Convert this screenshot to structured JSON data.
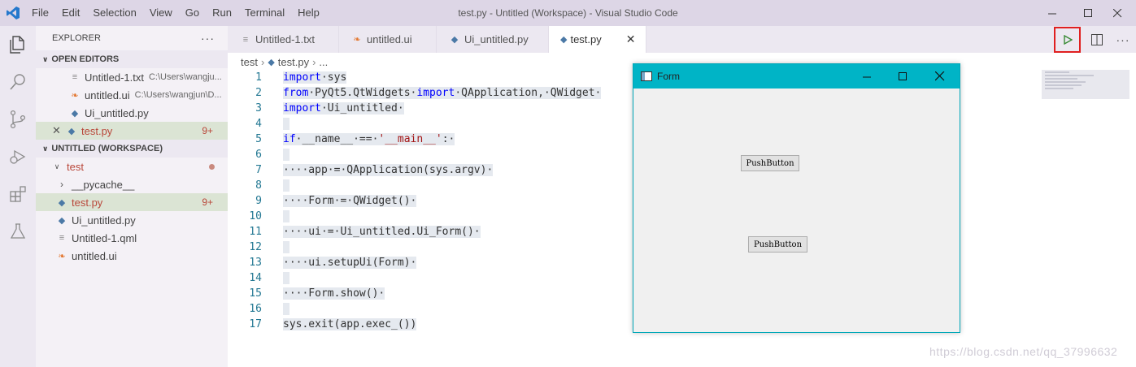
{
  "titlebar": {
    "menu": [
      "File",
      "Edit",
      "Selection",
      "View",
      "Go",
      "Run",
      "Terminal",
      "Help"
    ],
    "title": "test.py - Untitled (Workspace) - Visual Studio Code"
  },
  "sidebar": {
    "header": "EXPLORER",
    "more": "···",
    "open_editors": {
      "title": "OPEN EDITORS",
      "items": [
        {
          "name": "Untitled-1.txt",
          "path": "C:\\Users\\wangju..."
        },
        {
          "name": "untitled.ui",
          "path": "C:\\Users\\wangjun\\D..."
        },
        {
          "name": "Ui_untitled.py",
          "path": ""
        },
        {
          "name": "test.py",
          "path": "",
          "badge": "9+"
        }
      ]
    },
    "workspace": {
      "title": "UNTITLED (WORKSPACE)",
      "folder": "test",
      "items": [
        {
          "name": "__pycache__"
        },
        {
          "name": "test.py",
          "badge": "9+"
        },
        {
          "name": "Ui_untitled.py"
        },
        {
          "name": "Untitled-1.qml"
        },
        {
          "name": "untitled.ui"
        }
      ]
    }
  },
  "tabs": [
    {
      "label": "Untitled-1.txt"
    },
    {
      "label": "untitled.ui"
    },
    {
      "label": "Ui_untitled.py"
    },
    {
      "label": "test.py"
    }
  ],
  "breadcrumb": {
    "folder": "test",
    "file": "test.py",
    "rest": "..."
  },
  "editor": {
    "line_numbers": [
      "1",
      "2",
      "3",
      "4",
      "5",
      "6",
      "7",
      "8",
      "9",
      "10",
      "11",
      "12",
      "13",
      "14",
      "15",
      "16",
      "17"
    ]
  },
  "form": {
    "title": "Form",
    "button1": "PushButton",
    "button2": "PushButton"
  },
  "watermark": "https://blog.csdn.net/qq_37996632"
}
